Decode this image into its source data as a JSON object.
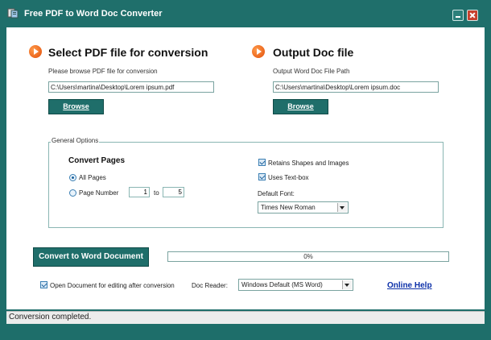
{
  "window": {
    "title": "Free PDF to Word Doc Converter"
  },
  "pdf_section": {
    "title": "Select PDF file for conversion",
    "hint": "Please browse PDF file for conversion",
    "path": "C:\\Users\\martina\\Desktop\\Lorem ipsum.pdf",
    "browse_label": "Browse"
  },
  "output_section": {
    "title": "Output Doc file",
    "hint": "Output Word Doc File Path",
    "path": "C:\\Users\\martina\\Desktop\\Lorem ipsum.doc",
    "browse_label": "Browse"
  },
  "general_options": {
    "legend": "General Options",
    "convert_pages_label": "Convert Pages",
    "all_pages_label": "All Pages",
    "all_pages_selected": true,
    "page_number_label": "Page Number",
    "page_number_selected": false,
    "page_from": "1",
    "to_label": "to",
    "page_to": "5",
    "retains_shapes_label": "Retains Shapes and Images",
    "retains_shapes_checked": true,
    "uses_textbox_label": "Uses Text-box",
    "uses_textbox_checked": true,
    "default_font_label": "Default Font:",
    "default_font_value": "Times New Roman"
  },
  "convert": {
    "button_label": "Convert to Word Document",
    "progress_text": "0%",
    "progress_fraction": 0
  },
  "bottom": {
    "open_doc_label": "Open Document for editing after conversion",
    "open_doc_checked": true,
    "doc_reader_label": "Doc Reader:",
    "doc_reader_value": "Windows Default (MS Word)",
    "online_help": "Online Help"
  },
  "status": {
    "text": "Conversion completed."
  },
  "icons": {
    "app": "app-icon",
    "minimize": "minimize-icon",
    "close": "close-icon",
    "section_arrow": "play-arrow-icon"
  },
  "colors": {
    "titlebar": "#1f6f6b",
    "button": "#1f6e6a",
    "accent_arrow": "#e24f0a",
    "link": "#0b2fa8"
  }
}
